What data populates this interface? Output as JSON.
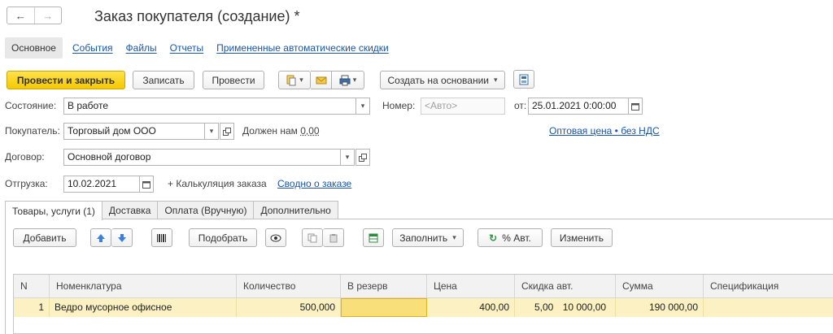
{
  "window": {
    "title": "Заказ покупателя (создание) *",
    "nav": {
      "back_icon": "arrow-left-icon",
      "forward_icon": "arrow-right-icon"
    }
  },
  "sections": [
    {
      "label": "Основное",
      "active": true
    },
    {
      "label": "События"
    },
    {
      "label": "Файлы"
    },
    {
      "label": "Отчеты"
    },
    {
      "label": "Примененные автоматические скидки"
    }
  ],
  "toolbar": {
    "post_and_close": "Провести и закрыть",
    "save": "Записать",
    "post": "Провести",
    "create_based_on": "Создать на основании"
  },
  "form": {
    "state_label": "Состояние:",
    "state_value": "В работе",
    "number_label": "Номер:",
    "number_placeholder": "<Авто>",
    "date_label": "от:",
    "date_value": "25.01.2021  0:00:00",
    "customer_label": "Покупатель:",
    "customer_value": "Торговый дом ООО",
    "debt_label": "Должен нам",
    "debt_value": "0,00",
    "price_type_link": "Оптовая цена • без НДС",
    "contract_label": "Договор:",
    "contract_value": "Основной договор",
    "shipment_label": "Отгрузка:",
    "shipment_value": "10.02.2021",
    "calc_label": "+ Калькуляция заказа",
    "summary_link": "Сводно о заказе"
  },
  "tabs": [
    {
      "label": "Товары, услуги (1)",
      "active": true
    },
    {
      "label": "Доставка"
    },
    {
      "label": "Оплата (Вручную)"
    },
    {
      "label": "Дополнительно"
    }
  ],
  "table_toolbar": {
    "add": "Добавить",
    "pick": "Подобрать",
    "fill": "Заполнить",
    "auto_pct": "% Авт.",
    "change": "Изменить"
  },
  "table": {
    "columns": [
      "N",
      "Номенклатура",
      "Количество",
      "В резерв",
      "Цена",
      "Скидка авт.",
      "Сумма",
      "Спецификация"
    ],
    "rows": [
      {
        "n": "1",
        "item": "Ведро мусорное офисное",
        "qty": "500,000",
        "reserve": "",
        "price": "400,00",
        "discount_pct": "5,00",
        "discount_sum": "10 000,00",
        "sum": "190 000,00",
        "spec": ""
      }
    ]
  },
  "colors": {
    "accent": "#f5c800",
    "link": "#1a55a6",
    "row_highlight": "#fbf1c2"
  }
}
